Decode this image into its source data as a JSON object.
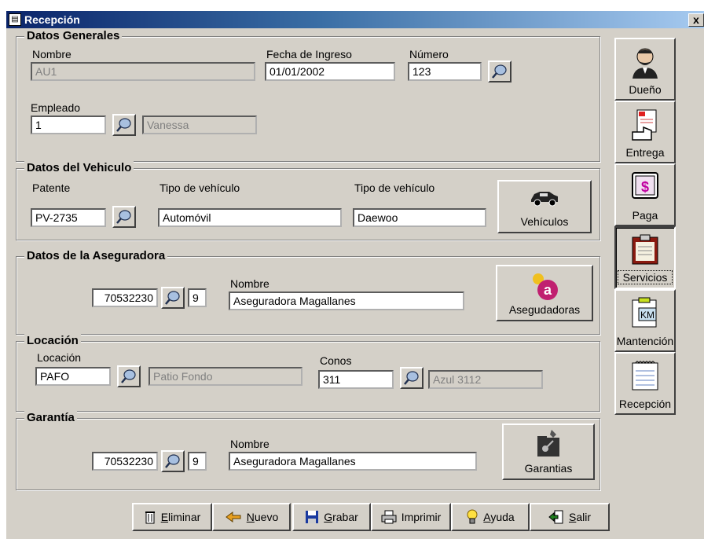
{
  "window": {
    "title": "Recepción",
    "close": "x"
  },
  "generales": {
    "legend": "Datos Generales",
    "nombre_label": "Nombre",
    "nombre_value": "AU1",
    "fecha_label": "Fecha de Ingreso",
    "fecha_value": "01/01/2002",
    "numero_label": "Número",
    "numero_value": "123",
    "empleado_label": "Empleado",
    "empleado_value": "1",
    "empleado_name": "Vanessa"
  },
  "vehiculo": {
    "legend": "Datos del Vehiculo",
    "patente_label": "Patente",
    "patente_value": "PV-2735",
    "tipo_label": "Tipo de vehículo",
    "tipo_value": "Automóvil",
    "tipo2_label": "Tipo de vehículo",
    "tipo2_value": "Daewoo",
    "button": "Vehículos"
  },
  "aseguradora": {
    "legend": "Datos de la Aseguradora",
    "rut_value": "70532230",
    "dv_value": "9",
    "nombre_label": "Nombre",
    "nombre_value": "Aseguradora Magallanes",
    "button": "Asegudadoras"
  },
  "locacion": {
    "legend": "Locación",
    "locacion_label": "Locación",
    "locacion_value": "PAFO",
    "locacion_name": "Patio Fondo",
    "conos_label": "Conos",
    "conos_value": "311",
    "conos_name": "Azul 3112"
  },
  "garantia": {
    "legend": "Garantía",
    "rut_value": "70532230",
    "dv_value": "9",
    "nombre_label": "Nombre",
    "nombre_value": "Aseguradora Magallanes",
    "button": "Garantias"
  },
  "sidebar": {
    "items": [
      {
        "label": "Dueño",
        "icon": "owner-portrait-icon"
      },
      {
        "label": "Entrega",
        "icon": "hand-document-icon"
      },
      {
        "label": "Paga",
        "icon": "dollar-icon"
      },
      {
        "label": "Servicios",
        "icon": "clipboard-icon"
      },
      {
        "label": "Mantención",
        "icon": "km-clipboard-icon"
      },
      {
        "label": "Recepción",
        "icon": "notepad-icon"
      }
    ]
  },
  "toolbar": {
    "eliminar_u": "E",
    "eliminar_rest": "liminar",
    "nuevo_u": "N",
    "nuevo_rest": "uevo",
    "grabar_u": "G",
    "grabar_rest": "rabar",
    "imprimir": "Imprimir",
    "ayuda_u": "A",
    "ayuda_rest": "yuda",
    "salir_u": "S",
    "salir_rest": "alir"
  }
}
